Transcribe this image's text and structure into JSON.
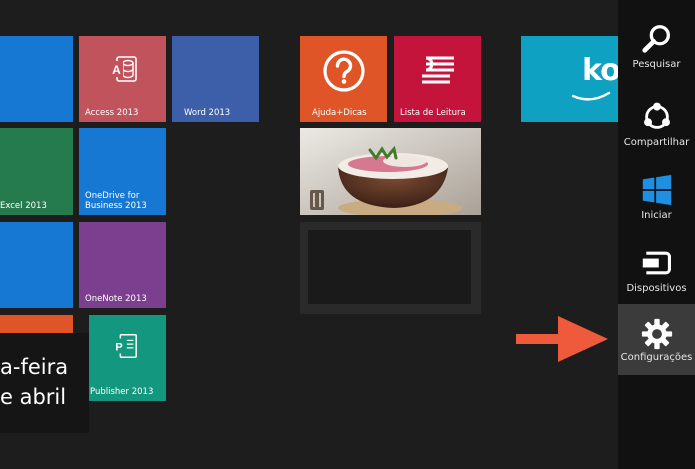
{
  "tiles": {
    "access": "Access 2013",
    "word": "Word 2013",
    "excel": "Excel 2013",
    "onedrive": "OneDrive for\nBusiness 2013",
    "onenote": "OneNote 2013",
    "publisher": "Publisher 2013",
    "ajuda": "Ajuda+Dicas",
    "lista": "Lista de Leitura",
    "kobo": "ko"
  },
  "date_tile": {
    "line1": "a-feira",
    "line2": "e abril"
  },
  "charms": [
    {
      "label": "Pesquisar",
      "icon": "search-icon"
    },
    {
      "label": "Compartilhar",
      "icon": "share-icon"
    },
    {
      "label": "Iniciar",
      "icon": "windows-logo-icon"
    },
    {
      "label": "Dispositivos",
      "icon": "devices-icon"
    },
    {
      "label": "Configurações",
      "icon": "settings-gear-icon"
    }
  ],
  "colors": {
    "background": "#1d1d1d",
    "charm_bar": "#111111",
    "charm_active": "#3b3b3b",
    "arrow": "#f05a3c",
    "access": "#c1535d",
    "word": "#3d5ea8",
    "excel": "#257a4e",
    "onedrive": "#1778d3",
    "onenote": "#7c3f8f",
    "publisher": "#14977f",
    "ajuda": "#e05527",
    "lista": "#c5143c",
    "kobo": "#0fa1c1"
  }
}
